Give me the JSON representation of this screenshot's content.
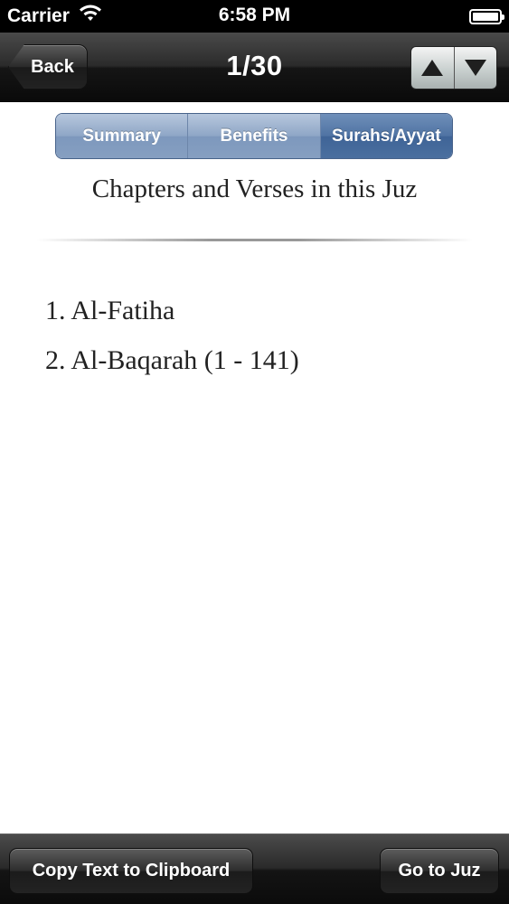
{
  "status_bar": {
    "carrier": "Carrier",
    "time": "6:58 PM",
    "wifi_icon": "wifi-icon",
    "battery_icon": "battery-icon",
    "battery_level": 1.0
  },
  "nav": {
    "back_label": "Back",
    "title": "1/30",
    "up_icon": "arrow-up-icon",
    "down_icon": "arrow-down-icon"
  },
  "segments": {
    "items": [
      "Summary",
      "Benefits",
      "Surahs/Ayyat"
    ],
    "selected": "Surahs/Ayyat"
  },
  "content": {
    "heading": "Chapters and Verses in this Juz",
    "chapters": [
      "1. Al-Fatiha",
      "2. Al-Baqarah (1 - 141)"
    ]
  },
  "toolbar": {
    "copy_label": "Copy Text to Clipboard",
    "goto_label": "Go to Juz"
  },
  "colors": {
    "segment_selected": "#4f73a3",
    "segment_normal": "#8ea6c6",
    "bar_background": "#1a1a1a"
  }
}
